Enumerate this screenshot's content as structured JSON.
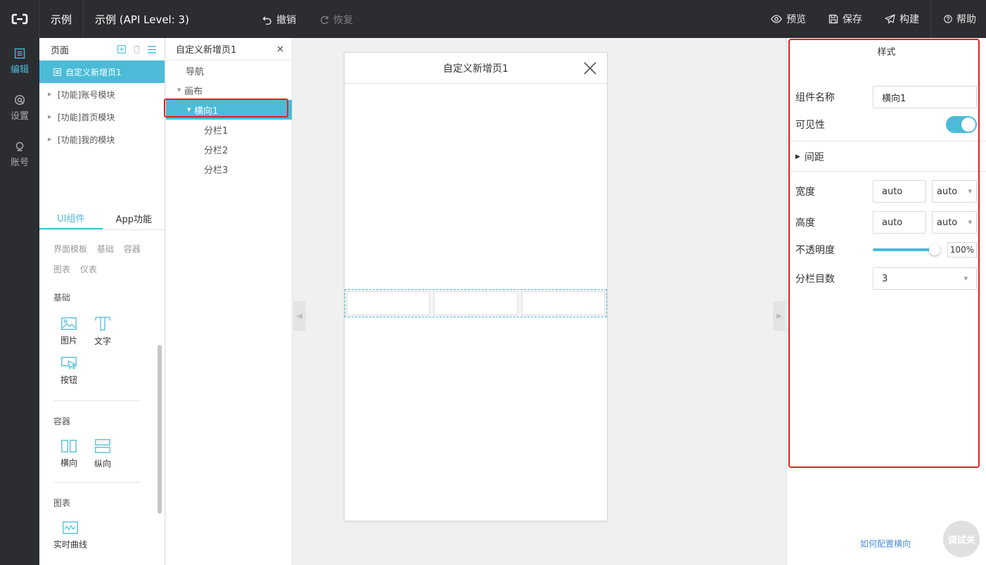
{
  "topbar": {
    "app_name": "示例",
    "project": "示例 (API Level: 3)",
    "undo": "撤销",
    "redo": "恢复",
    "preview": "预览",
    "save": "保存",
    "build": "构建",
    "help": "帮助"
  },
  "rail": {
    "items": [
      {
        "label": "编辑",
        "icon": "edit-icon"
      },
      {
        "label": "设置",
        "icon": "settings-icon"
      },
      {
        "label": "账号",
        "icon": "account-icon"
      }
    ]
  },
  "pages": {
    "title": "页面",
    "items": [
      {
        "label": "自定义新增页1"
      },
      {
        "label": "[功能]账号模块"
      },
      {
        "label": "[功能]首页模块"
      },
      {
        "label": "[功能]我的模块"
      }
    ]
  },
  "components": {
    "tabs": [
      "UI组件",
      "App功能"
    ],
    "filters": [
      "界面模板",
      "基础",
      "容器",
      "图表",
      "仪表"
    ],
    "sections": [
      {
        "title": "基础",
        "items": [
          "图片",
          "文字",
          "按钮"
        ]
      },
      {
        "title": "容器",
        "items": [
          "横向",
          "纵向"
        ]
      },
      {
        "title": "图表",
        "items": [
          "实时曲线"
        ]
      }
    ]
  },
  "tree": {
    "title": "自定义新增页1",
    "nodes": [
      {
        "label": "导航"
      },
      {
        "label": "画布"
      },
      {
        "label": "横向1"
      },
      {
        "label": "分栏1"
      },
      {
        "label": "分栏2"
      },
      {
        "label": "分栏3"
      }
    ]
  },
  "canvas": {
    "phone_title": "自定义新增页1"
  },
  "props": {
    "title": "样式",
    "name_label": "组件名称",
    "name_value": "横向1",
    "visible_label": "可见性",
    "spacing_label": "间距",
    "width_label": "宽度",
    "width_value": "auto",
    "width_unit": "auto",
    "height_label": "高度",
    "height_value": "auto",
    "height_unit": "auto",
    "opacity_label": "不透明度",
    "opacity_value": "100%",
    "columns_label": "分栏目数",
    "columns_value": "3",
    "help_link": "如何配置横向",
    "debug_button": "调试关"
  },
  "colors": {
    "accent": "#4bbbd8",
    "topbar": "#2b2d31",
    "highlight": "#e02020"
  }
}
